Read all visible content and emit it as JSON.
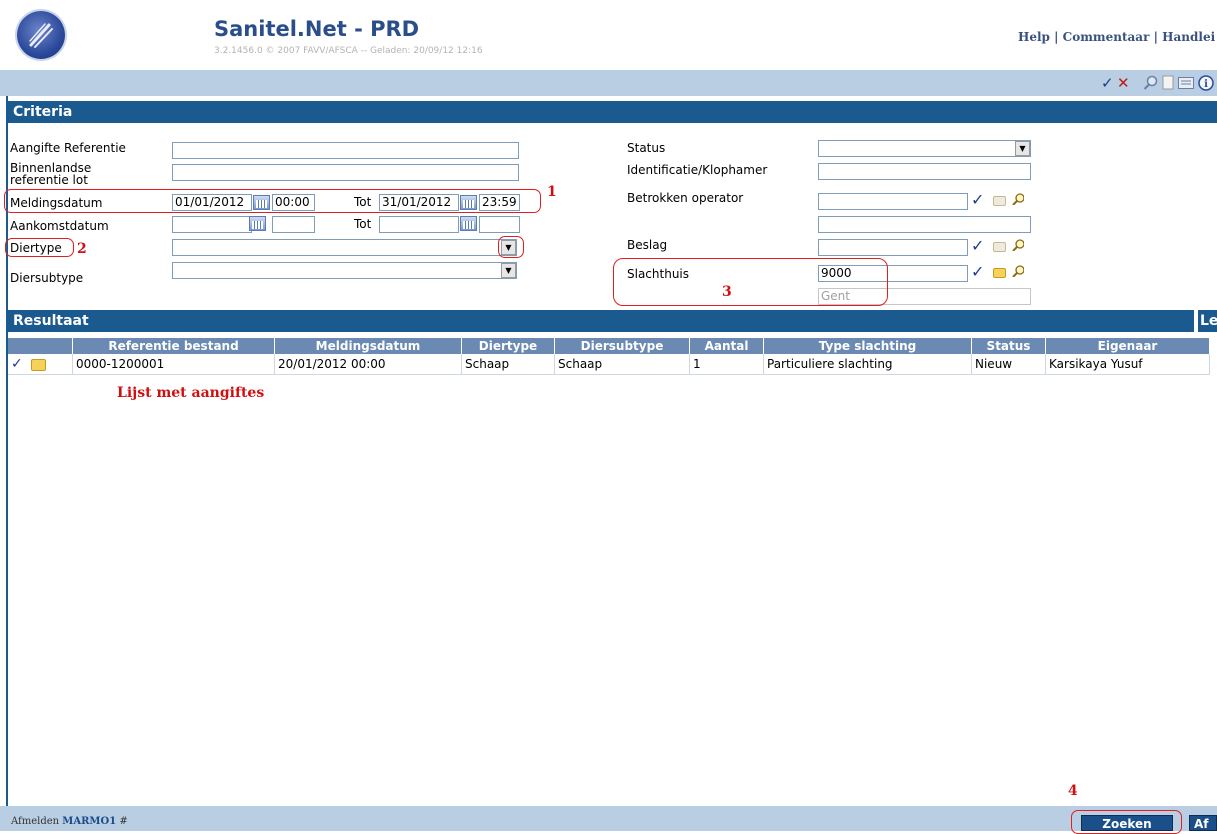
{
  "header": {
    "title": "Sanitel.Net - PRD",
    "version": "3.2.1456.0 © 2007 FAVV/AFSCA -- Geladen: 20/09/12 12:16",
    "links": [
      "Help",
      "Commentaar",
      "Handlei"
    ]
  },
  "toolbar": {
    "icons": [
      "check-icon",
      "delete-icon",
      "search-icon",
      "new-document-icon",
      "list-icon",
      "info-icon"
    ],
    "check_glyph": "✓",
    "delete_glyph": "✕"
  },
  "criteria": {
    "title": "Criteria",
    "aangifte_referentie_label": "Aangifte Referentie",
    "aangifte_referentie_value": "",
    "binnenlandse_label": "Binnenlandse referentie lot",
    "binnenlandse_value": "",
    "meldingsdatum_label": "Meldingsdatum",
    "meldingsdatum_from_date": "01/01/2012",
    "meldingsdatum_from_time": "00:00",
    "tot_label": "Tot",
    "meldingsdatum_to_date": "31/01/2012",
    "meldingsdatum_to_time": "23:59",
    "aankomstdatum_label": "Aankomstdatum",
    "aankomstdatum_from_date": "",
    "aankomstdatum_from_time": "",
    "aankomstdatum_to_date": "",
    "aankomstdatum_to_time": "",
    "diertype_label": "Diertype",
    "diertype_value": "",
    "diersubtype_label": "Diersubtype",
    "diersubtype_value": "",
    "status_label": "Status",
    "status_value": "",
    "identificatie_label": "Identificatie/Klophamer",
    "identificatie_value": "",
    "betrokken_operator_label": "Betrokken operator",
    "betrokken_operator_value": "",
    "betrokken_operator_name": "",
    "beslag_label": "Beslag",
    "beslag_value": "",
    "slachthuis_label": "Slachthuis",
    "slachthuis_value": "9000",
    "slachthuis_name": "Gent"
  },
  "annotations": {
    "n1": "1",
    "n2": "2",
    "n3": "3",
    "n4": "4",
    "list_note": "Lijst met aangiftes"
  },
  "results": {
    "title": "Resultaat",
    "extra_tab": "Le",
    "columns": [
      "Referentie bestand",
      "Meldingsdatum",
      "Diertype",
      "Diersubtype",
      "Aantal",
      "Type slachting",
      "Status",
      "Eigenaar"
    ],
    "rows": [
      {
        "referentie": "0000-1200001",
        "meldingsdatum": "20/01/2012 00:00",
        "diertype": "Schaap",
        "diersubtype": "Schaap",
        "aantal": "1",
        "type_slachting": "Particuliere slachting",
        "status": "Nieuw",
        "eigenaar": "Karsikaya Yusuf"
      }
    ]
  },
  "footer": {
    "afmelden": "Afmelden",
    "user": "MARMO1",
    "hash": "#",
    "zoeken": "Zoeken",
    "next_button": "Af"
  },
  "colors": {
    "section_bar": "#1b5a8e",
    "header_row": "#6a89b3",
    "toolbar": "#b9cee2",
    "annotation_red": "#e02020"
  }
}
